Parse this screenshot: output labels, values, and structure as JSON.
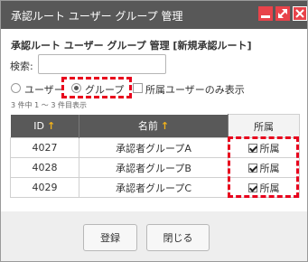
{
  "window": {
    "title": "承認ルート ユーザー グループ 管理",
    "colors": {
      "titlebar": "#585858",
      "window_button": "#e8434a",
      "highlight": "#e8001c"
    }
  },
  "heading": "承認ルート ユーザー グループ 管理 [新規承認ルート]",
  "search": {
    "label": "検索:",
    "value": "",
    "placeholder": ""
  },
  "filter": {
    "user_label": "ユーザー",
    "group_label": "グループ",
    "selected": "グループ",
    "own_only_label": "所属ユーザーのみ表示",
    "own_only_checked": false
  },
  "count_text": "3 件中 1 ～ 3 件目表示",
  "table": {
    "headers": {
      "id": "ID",
      "name": "名前",
      "membership": "所属"
    },
    "rows": [
      {
        "id": "4027",
        "name": "承認者グループA",
        "membership": "所属",
        "checked": true
      },
      {
        "id": "4028",
        "name": "承認者グループB",
        "membership": "所属",
        "checked": true
      },
      {
        "id": "4029",
        "name": "承認者グループC",
        "membership": "所属",
        "checked": true
      }
    ]
  },
  "footer": {
    "register_label": "登録",
    "close_label": "閉じる"
  }
}
